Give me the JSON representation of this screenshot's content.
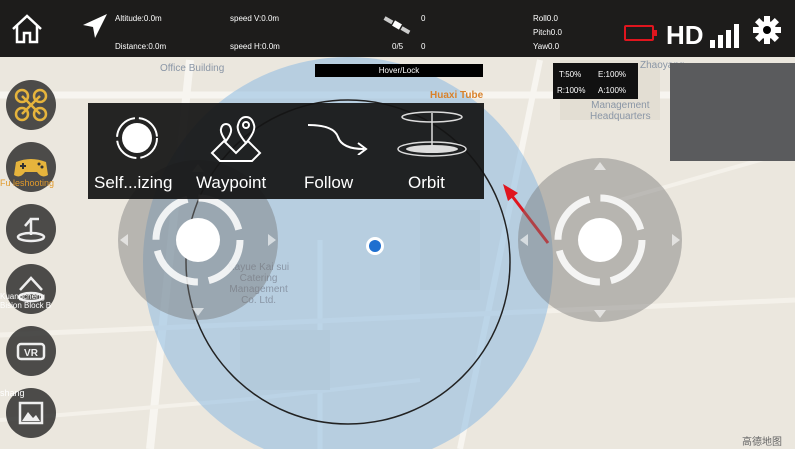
{
  "map": {
    "pois": [
      {
        "id": "office-building",
        "text": "Office Building",
        "style": "blue"
      },
      {
        "id": "huaxi-tube",
        "text": "Huaxi Tube",
        "style": "orange"
      },
      {
        "id": "management-hq",
        "text": "Management\nHeadquarters",
        "style": "blue"
      },
      {
        "id": "catering",
        "text": "Kayue Kai sui\nCatering\nManagement\nCo. Ltd.",
        "style": "blue"
      },
      {
        "id": "zhaoyang",
        "text": "Zhaoyang",
        "style": "blue"
      }
    ],
    "watermark": "高德地图"
  },
  "topbar": {
    "altitude": "Altitude:0.0m",
    "distance": "Distance:0.0m",
    "speed_v": "speed V:0.0m",
    "speed_h": "speed H:0.0m",
    "satellites": "0",
    "gps_ratio": "0/5",
    "gps_count": "0",
    "roll": "Roll0.0",
    "pitch": "Pitch0.0",
    "yaw": "Yaw0.0",
    "hd_label": "HD",
    "colors": {
      "battery": "#e0151e"
    }
  },
  "status": {
    "hover_lock": "Hover/Lock",
    "t_pct": "T:50%",
    "e_pct": "E:100%",
    "r_pct": "R:100%",
    "a_pct": "A:100%"
  },
  "sidebar": {
    "items": [
      {
        "icon": "drone-icon",
        "label": ""
      },
      {
        "icon": "gamepad-icon",
        "label": "Fu leshooting"
      },
      {
        "icon": "takeoff-land-icon",
        "label": ""
      },
      {
        "icon": "return-home-icon",
        "label": "Kuangcheng\nBision Block B"
      },
      {
        "icon": "vr-icon",
        "label": "VR"
      },
      {
        "icon": "gallery-icon",
        "label": "shang"
      }
    ]
  },
  "flight_modes": [
    {
      "id": "self-stabilizing",
      "label": "Self...izing",
      "icon": "self-stabilizing-icon"
    },
    {
      "id": "waypoint",
      "label": "Waypoint",
      "icon": "waypoint-icon"
    },
    {
      "id": "follow",
      "label": "Follow",
      "icon": "follow-icon"
    },
    {
      "id": "orbit",
      "label": "Orbit",
      "icon": "orbit-icon"
    }
  ]
}
